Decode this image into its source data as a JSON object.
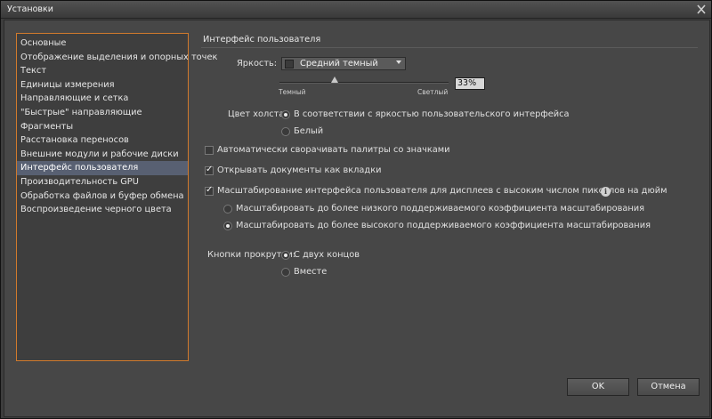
{
  "window": {
    "title": "Установки"
  },
  "sidebar": {
    "items": [
      {
        "label": "Основные"
      },
      {
        "label": "Отображение выделения и опорных точек"
      },
      {
        "label": "Текст"
      },
      {
        "label": "Единицы измерения"
      },
      {
        "label": "Направляющие и сетка"
      },
      {
        "label": "\"Быстрые\" направляющие"
      },
      {
        "label": "Фрагменты"
      },
      {
        "label": "Расстановка переносов"
      },
      {
        "label": "Внешние модули и рабочие диски"
      },
      {
        "label": "Интерфейс пользователя"
      },
      {
        "label": "Производительность GPU"
      },
      {
        "label": "Обработка файлов и буфер обмена"
      },
      {
        "label": "Воспроизведение черного цвета"
      }
    ],
    "active_index": 9,
    "accent_color": "#d17a2c",
    "active_color": "#586072"
  },
  "ui": {
    "section_title": "Интерфейс пользователя",
    "brightness": {
      "label": "Яркость:",
      "selected": "Средний темный",
      "slider_left_label": "Темный",
      "slider_right_label": "Светлый",
      "value": "33%"
    },
    "canvas_color": {
      "label": "Цвет холста:",
      "options": [
        {
          "label": "В соответствии с яркостью пользовательского интерфейса",
          "selected": true
        },
        {
          "label": "Белый",
          "selected": false
        }
      ]
    },
    "auto_collapse": {
      "label": "Автоматически сворачивать палитры со значками",
      "checked": false
    },
    "open_as_tabs": {
      "label": "Открывать документы как вкладки",
      "checked": true
    },
    "hidpi_scaling": {
      "label": "Масштабирование интерфейса пользователя для дисплеев с высоким числом пикселов на дюйм",
      "checked": true,
      "info_icon": "info-icon",
      "options": [
        {
          "label": "Масштабировать до более низкого поддерживаемого коэффициента масштабирования",
          "selected": false
        },
        {
          "label": "Масштабировать до более высокого поддерживаемого коэффициента масштабирования",
          "selected": true
        }
      ]
    },
    "scroll_buttons": {
      "label": "Кнопки прокрутки:",
      "options": [
        {
          "label": "С двух концов",
          "selected": true
        },
        {
          "label": "Вместе",
          "selected": false
        }
      ]
    }
  },
  "footer": {
    "ok_label": "OK",
    "cancel_label": "Отмена"
  }
}
